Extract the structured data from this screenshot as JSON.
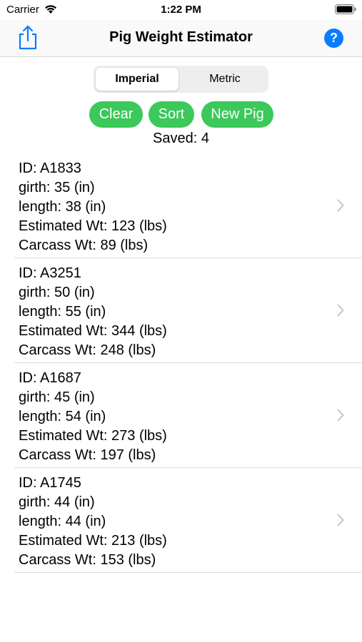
{
  "status_bar": {
    "carrier": "Carrier",
    "time": "1:22 PM"
  },
  "nav": {
    "title": "Pig Weight Estimator",
    "help_label": "?"
  },
  "segmented": {
    "options": [
      "Imperial",
      "Metric"
    ],
    "selected": "Imperial"
  },
  "buttons": {
    "clear": "Clear",
    "sort": "Sort",
    "new_pig": "New Pig"
  },
  "saved_text": "Saved: 4",
  "colors": {
    "accent_green": "#3cc85a",
    "accent_blue": "#0a7cff"
  },
  "pigs": [
    {
      "id": "ID: A1833",
      "girth": "girth: 35 (in)",
      "length": "length: 38 (in)",
      "est": "Estimated Wt: 123 (lbs)",
      "carcass": "Carcass Wt: 89 (lbs)"
    },
    {
      "id": "ID: A3251",
      "girth": "girth: 50 (in)",
      "length": "length: 55 (in)",
      "est": "Estimated Wt: 344 (lbs)",
      "carcass": "Carcass Wt: 248 (lbs)"
    },
    {
      "id": "ID: A1687",
      "girth": "girth: 45 (in)",
      "length": "length: 54 (in)",
      "est": "Estimated Wt: 273 (lbs)",
      "carcass": "Carcass Wt: 197 (lbs)"
    },
    {
      "id": "ID: A1745",
      "girth": "girth: 44 (in)",
      "length": "length: 44 (in)",
      "est": "Estimated Wt: 213 (lbs)",
      "carcass": "Carcass Wt: 153 (lbs)"
    }
  ]
}
